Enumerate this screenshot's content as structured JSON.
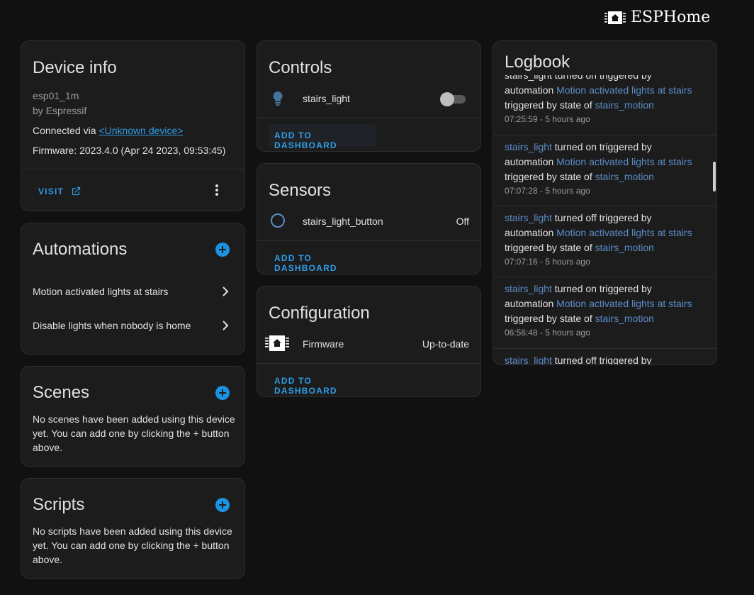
{
  "brand": {
    "logo_text": "ESPHome"
  },
  "device_info": {
    "title": "Device info",
    "model": "esp01_1m",
    "manufacturer": "by Espressif",
    "connected_prefix": "Connected via ",
    "connected_link": "<Unknown device>",
    "firmware": "Firmware: 2023.4.0 (Apr 24 2023, 09:53:45)",
    "visit_label": "VISIT"
  },
  "automations": {
    "title": "Automations",
    "items": [
      {
        "label": "Motion activated lights at stairs"
      },
      {
        "label": "Disable lights when nobody is home"
      }
    ]
  },
  "scenes": {
    "title": "Scenes",
    "empty_text": "No scenes have been added using this device yet. You can add one by clicking the + button above."
  },
  "scripts": {
    "title": "Scripts",
    "empty_text": "No scripts have been added using this device yet. You can add one by clicking the + button above."
  },
  "controls": {
    "title": "Controls",
    "entity": "stairs_light",
    "toggle_on": false,
    "add_label": "ADD TO DASHBOARD"
  },
  "sensors": {
    "title": "Sensors",
    "entity": "stairs_light_button",
    "state": "Off",
    "add_label": "ADD TO DASHBOARD"
  },
  "configuration": {
    "title": "Configuration",
    "entity": "Firmware",
    "state": "Up-to-date",
    "add_label": "ADD TO DASHBOARD"
  },
  "logbook": {
    "title": "Logbook",
    "partial_top": "stairs_light turned on triggered by",
    "entries": [
      {
        "entity": "",
        "action": "",
        "automation_prefix": "automation ",
        "automation": "Motion activated lights at stairs",
        "state_prefix": "triggered by state of ",
        "state_entity": "stairs_motion",
        "time": "07:25:59 - 5 hours ago"
      },
      {
        "entity": "stairs_light",
        "action": " turned on triggered by",
        "automation_prefix": "automation ",
        "automation": "Motion activated lights at stairs",
        "state_prefix": "triggered by state of ",
        "state_entity": "stairs_motion",
        "time": "07:07:28 - 5 hours ago"
      },
      {
        "entity": "stairs_light",
        "action": " turned off triggered by",
        "automation_prefix": "automation ",
        "automation": "Motion activated lights at stairs",
        "state_prefix": "triggered by state of ",
        "state_entity": "stairs_motion",
        "time": "07:07:16 - 5 hours ago"
      },
      {
        "entity": "stairs_light",
        "action": " turned on triggered by",
        "automation_prefix": "automation ",
        "automation": "Motion activated lights at stairs",
        "state_prefix": "triggered by state of ",
        "state_entity": "stairs_motion",
        "time": "06:56:48 - 5 hours ago"
      },
      {
        "entity": "stairs_light",
        "action": " turned off triggered by",
        "automation_prefix": "",
        "automation": "",
        "state_prefix": "",
        "state_entity": "",
        "time": ""
      }
    ]
  },
  "colors": {
    "background": "#111111",
    "card": "#1c1c1c",
    "accent": "#2e9ee8",
    "entity_link": "#5b8cc8"
  }
}
